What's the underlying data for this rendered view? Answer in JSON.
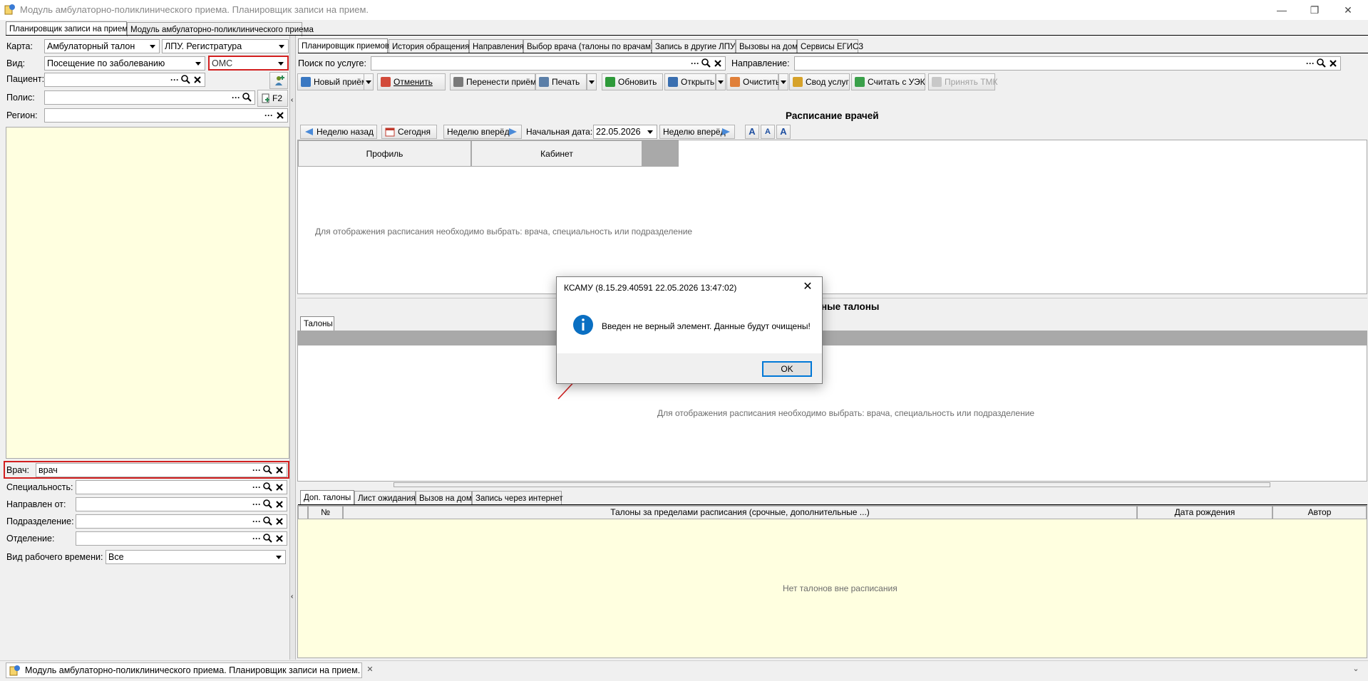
{
  "window": {
    "title": "Модуль амбулаторно-поликлинического приема. Планировщик записи на прием.",
    "minimize": "—",
    "restore": "❐",
    "close": "✕"
  },
  "main_tabs": [
    {
      "label": "Планировщик записи на прием"
    },
    {
      "label": "Модуль амбулаторно-поликлинического приема"
    }
  ],
  "left": {
    "karta_label": "Карта:",
    "karta_value": "Амбулаторный талон",
    "lpu_value": "ЛПУ. Регистратура",
    "vid_label": "Вид:",
    "vid_value": "Посещение по заболеванию",
    "oms_value": "ОМС",
    "patient_label": "Пациент:",
    "polis_label": "Полис:",
    "f2_label": "F2",
    "region_label": "Регион:",
    "vrach_label": "Врач:",
    "vrach_value": "врач",
    "spec_label": "Специальность:",
    "napravlen_label": "Направлен от:",
    "podrazd_label": "Подразделение:",
    "otdel_label": "Отделение:",
    "worktime_label": "Вид рабочего времени:",
    "worktime_value": "Все"
  },
  "right_tabs": [
    {
      "label": "Планировщик приемов"
    },
    {
      "label": "История обращения"
    },
    {
      "label": "Направления"
    },
    {
      "label": "Выбор врача (талоны по врачам)"
    },
    {
      "label": "Запись в другие ЛПУ"
    },
    {
      "label": "Вызовы на дом"
    },
    {
      "label": "Сервисы ЕГИСЗ"
    }
  ],
  "search": {
    "service_label": "Поиск по услуге:",
    "direction_label": "Направление:"
  },
  "toolbar": {
    "new": "Новый приём",
    "cancel": "Отменить",
    "move": "Перенести приём",
    "print": "Печать",
    "refresh": "Обновить",
    "open": "Открыть",
    "clear": "Очистить",
    "summary": "Свод услуг",
    "read_uek": "Считать с УЭК",
    "accept_tmk": "Принять ТМК"
  },
  "schedule": {
    "title": "Расписание врачей",
    "week_back": "Неделю назад",
    "today": "Сегодня",
    "week_forward_1": "Неделю вперёд",
    "start_date_label": "Начальная дата:",
    "start_date": "22.05.2026",
    "week_forward_2": "Неделю вперёд",
    "font_a1": "A",
    "font_a2": "A",
    "font_a3": "A",
    "col_profile": "Профиль",
    "col_cabinet": "Кабинет",
    "hint": "Для отображения расписания необходимо выбрать: врача, специальность или подразделение"
  },
  "talons": {
    "title_partial": "ные талоны",
    "tab": "Талоны",
    "hint": "Для отображения расписания необходимо выбрать: врача, специальность или подразделение"
  },
  "bottom_tabs": [
    {
      "label": "Доп. талоны"
    },
    {
      "label": "Лист ожидания"
    },
    {
      "label": "Вызов на дом"
    },
    {
      "label": "Запись через интернет"
    }
  ],
  "bottom_grid": {
    "col_num": "№",
    "col_talons": "Талоны за пределами расписания (срочные, дополнительные ...)",
    "col_birth": "Дата рождения",
    "col_author": "Автор",
    "empty": "Нет талонов вне расписания"
  },
  "dialog": {
    "title": "КСАМУ (8.15.29.40591 22.05.2026 13:47:02)",
    "message": "Введен не верный элемент. Данные будут очищены!",
    "ok": "OK"
  },
  "statusbar": {
    "task": "Модуль амбулаторно-поликлинического приема. Планировщик записи на прием."
  },
  "colors": {
    "accent": "#0078d7",
    "error_frame": "#d21f1f",
    "panel_yellow": "#ffffe0",
    "info_icon": "#0a6fc2"
  }
}
